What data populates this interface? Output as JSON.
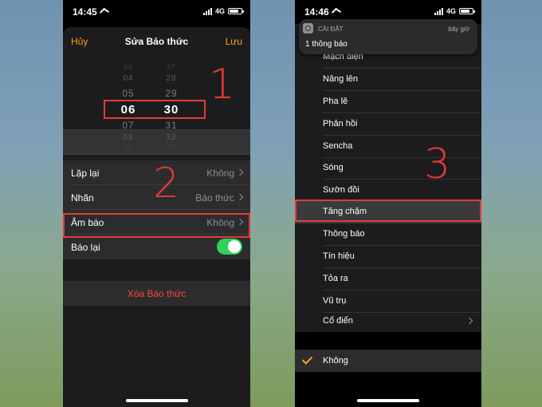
{
  "left_phone": {
    "status": {
      "time": "14:45",
      "network": "4G"
    },
    "nav": {
      "cancel": "Hủy",
      "title": "Sửa Báo thức",
      "save": "Lưu"
    },
    "picker": {
      "hours": [
        "03",
        "04",
        "05",
        "06",
        "07",
        "08",
        "09"
      ],
      "minutes": [
        "27",
        "28",
        "29",
        "30",
        "31",
        "32",
        "33"
      ],
      "selected_hour": "06",
      "selected_minute": "30"
    },
    "settings": [
      {
        "label": "Lặp lại",
        "value": "Không"
      },
      {
        "label": "Nhãn",
        "value": "Báo thức"
      },
      {
        "label": "Âm báo",
        "value": "Không"
      },
      {
        "label": "Báo lại",
        "toggle": true
      }
    ],
    "delete_label": "Xóa Báo thức"
  },
  "right_phone": {
    "status": {
      "time": "14:46",
      "network": "4G"
    },
    "notification": {
      "app": "CÀI ĐẶT",
      "time": "bây giờ",
      "message": "1 thông báo"
    },
    "tones": [
      "Mạch điện",
      "Nâng lên",
      "Pha lê",
      "Phản hồi",
      "Sencha",
      "Sóng",
      "Sườn đồi",
      "Tăng chậm",
      "Thông báo",
      "Tín hiệu",
      "Tỏa ra",
      "Vũ trụ",
      "Cổ điển"
    ],
    "highlighted_tone": "Tăng chậm",
    "selected": "Không"
  },
  "step_numbers": [
    "1",
    "2",
    "3"
  ],
  "colors": {
    "accent": "#ff9f0a",
    "highlight_box": "#e53935",
    "toggle_on": "#30d158",
    "destructive": "#ff453a"
  },
  "icons": [
    "location-arrow-icon",
    "signal-bars-icon",
    "battery-icon",
    "chevron-right-icon",
    "checkmark-icon",
    "settings-app-icon"
  ]
}
